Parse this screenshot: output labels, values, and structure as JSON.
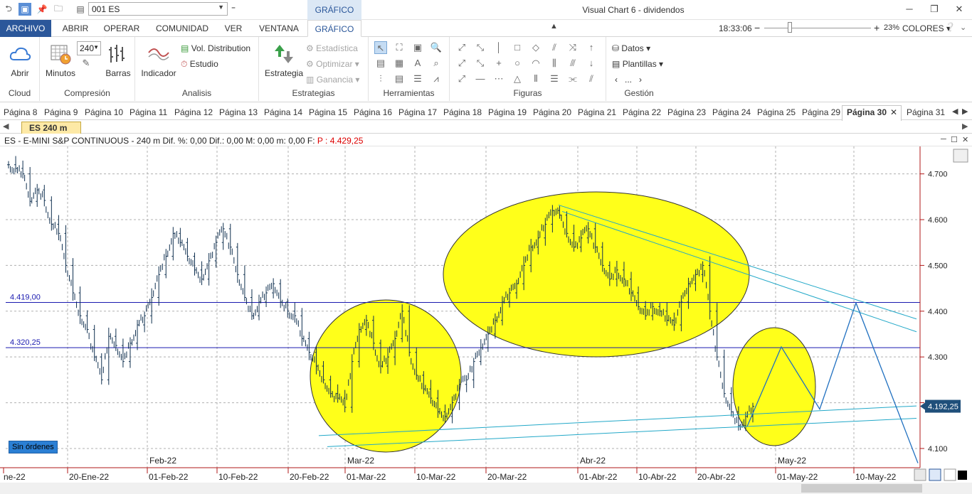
{
  "window": {
    "title": "Visual Chart 6 - dividendos"
  },
  "symbol_box": {
    "value": "001 ES"
  },
  "context_tab": "GRÁFICO",
  "ribbon_tabs": [
    "ARCHIVO",
    "ABRIR",
    "OPERAR",
    "COMUNIDAD",
    "VER",
    "VENTANA",
    "GRÁFICO"
  ],
  "status": {
    "clock": "18:33:06",
    "zoom": "23%",
    "colores": "COLORES"
  },
  "ribbon": {
    "cloud": {
      "label": "Cloud",
      "btn": "Abrir"
    },
    "compresion": {
      "label": "Compresión",
      "value": "240",
      "minutos": "Minutos",
      "barras": "Barras"
    },
    "analisis": {
      "label": "Analisis",
      "indicador": "Indicador",
      "vol": "Vol. Distribution",
      "estudio": "Estudio"
    },
    "estrategias": {
      "label": "Estrategias",
      "estrategia": "Estrategia",
      "estadistica": "Estadística",
      "optimizar": "Optimizar",
      "ganancia": "Ganancia"
    },
    "herramientas": {
      "label": "Herramientas"
    },
    "figuras": {
      "label": "Figuras"
    },
    "gestion": {
      "label": "Gestión",
      "datos": "Datos",
      "plantillas": "Plantillas",
      "dots": "..."
    }
  },
  "page_tabs": [
    "Página 8",
    "Página 9",
    "Página 10",
    "Página 11",
    "Página 12",
    "Página 13",
    "Página 14",
    "Página 15",
    "Página 16",
    "Página 17",
    "Página 18",
    "Página 19",
    "Página 20",
    "Página 21",
    "Página 22",
    "Página 23",
    "Página 24",
    "Página 25",
    "Página 29",
    "Página 30",
    "Página 31"
  ],
  "active_page": "Página 30",
  "doc_tab": "ES 240 m",
  "chart_header": {
    "text": "ES - E-MINI S&P CONTINUOUS -  240 m  Dif. %: 0,00  Dif.: 0,00  M: 0,00  m: 0,00  F:",
    "price": "P : 4.429,25"
  },
  "sin_ordenes": "Sin órdenes",
  "chart_data": {
    "type": "candlestick",
    "symbol": "ES - E-MINI S&P CONTINUOUS",
    "timeframe": "240 m",
    "y_ticks": [
      "4.700",
      "4.600",
      "4.500",
      "4.400",
      "4.300",
      "4.200",
      "4.100"
    ],
    "y_tick_values": [
      4700,
      4600,
      4500,
      4400,
      4300,
      4200,
      4100
    ],
    "y_range": [
      4058,
      4760
    ],
    "x_ticks": [
      "ne-22",
      "20-Ene-22",
      "01-Feb-22",
      "10-Feb-22",
      "20-Feb-22",
      "01-Mar-22",
      "10-Mar-22",
      "20-Mar-22",
      "01-Abr-22",
      "10-Abr-22",
      "20-Abr-22",
      "01-May-22",
      "10-May-22"
    ],
    "month_labels": [
      "Feb-22",
      "Mar-22",
      "Abr-22",
      "May-22"
    ],
    "hlines": [
      {
        "label": "4.419,00",
        "value": 4419
      },
      {
        "label": "4.320,25",
        "value": 4320.25
      }
    ],
    "last_price": "4.192,25",
    "close_series": [
      4720,
      4712,
      4700,
      4640,
      4665,
      4642,
      4590,
      4570,
      4500,
      4440,
      4390,
      4360,
      4300,
      4250,
      4345,
      4325,
      4290,
      4330,
      4370,
      4390,
      4430,
      4480,
      4520,
      4570,
      4550,
      4520,
      4490,
      4470,
      4510,
      4550,
      4580,
      4540,
      4480,
      4430,
      4390,
      4420,
      4440,
      4460,
      4420,
      4400,
      4390,
      4340,
      4310,
      4280,
      4250,
      4220,
      4210,
      4190,
      4290,
      4360,
      4380,
      4330,
      4280,
      4300,
      4340,
      4400,
      4310,
      4260,
      4230,
      4210,
      4180,
      4170,
      4200,
      4240,
      4250,
      4290,
      4320,
      4350,
      4380,
      4420,
      4440,
      4460,
      4500,
      4540,
      4560,
      4590,
      4620,
      4610,
      4570,
      4540,
      4560,
      4580,
      4540,
      4500,
      4470,
      4490,
      4470,
      4440,
      4410,
      4390,
      4410,
      4400,
      4380,
      4370,
      4420,
      4460,
      4480,
      4500,
      4400,
      4300,
      4220,
      4180,
      4150,
      4170,
      4192
    ]
  }
}
